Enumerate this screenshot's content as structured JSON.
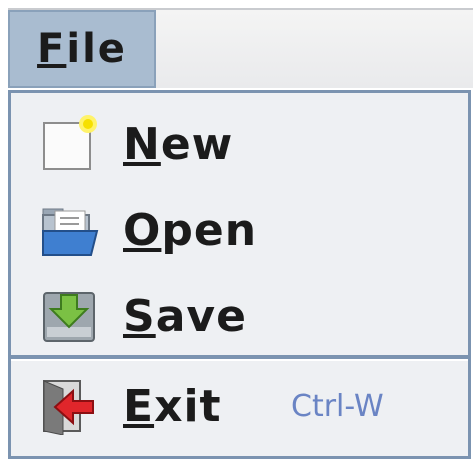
{
  "menubar": {
    "file_label": "File"
  },
  "menu": {
    "items": [
      {
        "label": "New",
        "icon": "new-document-icon"
      },
      {
        "label": "Open",
        "icon": "open-folder-icon"
      },
      {
        "label": "Save",
        "icon": "save-icon"
      }
    ],
    "exit": {
      "label": "Exit",
      "shortcut": "Ctrl-W",
      "icon": "exit-icon"
    }
  }
}
